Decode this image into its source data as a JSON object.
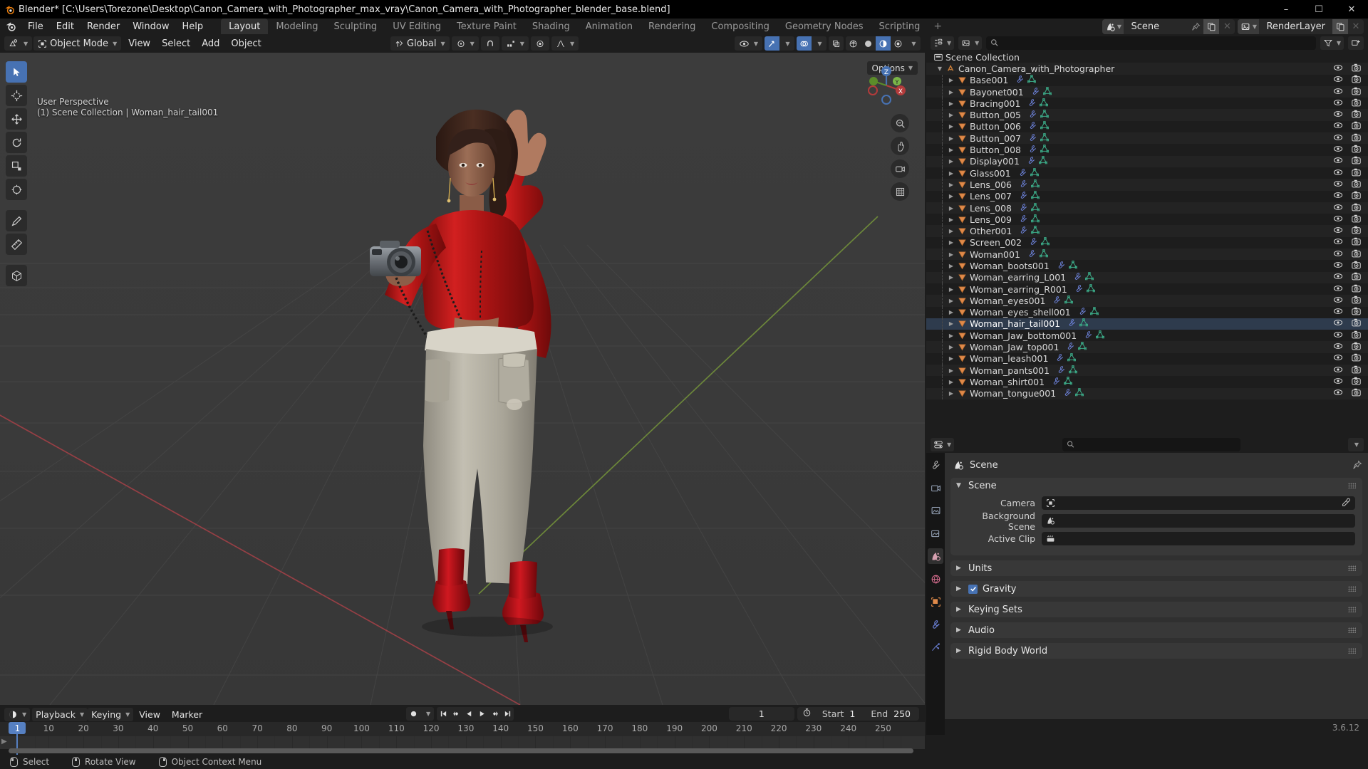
{
  "titlebar": {
    "text": "Blender* [C:\\Users\\Torezone\\Desktop\\Canon_Camera_with_Photographer_max_vray\\Canon_Camera_with_Photographer_blender_base.blend]",
    "minimize": "–",
    "maximize": "☐",
    "close": "✕"
  },
  "topbar": {
    "menus": [
      "File",
      "Edit",
      "Render",
      "Window",
      "Help"
    ],
    "workspaces": [
      {
        "label": "Layout",
        "active": true
      },
      {
        "label": "Modeling",
        "active": false
      },
      {
        "label": "Sculpting",
        "active": false
      },
      {
        "label": "UV Editing",
        "active": false
      },
      {
        "label": "Texture Paint",
        "active": false
      },
      {
        "label": "Shading",
        "active": false
      },
      {
        "label": "Animation",
        "active": false
      },
      {
        "label": "Rendering",
        "active": false
      },
      {
        "label": "Compositing",
        "active": false
      },
      {
        "label": "Geometry Nodes",
        "active": false
      },
      {
        "label": "Scripting",
        "active": false
      }
    ],
    "add_workspace": "+",
    "scene_name": "Scene",
    "viewlayer_name": "RenderLayer"
  },
  "viewport": {
    "mode": "Object Mode",
    "menus": [
      "View",
      "Select",
      "Add",
      "Object"
    ],
    "transform_orientation": "Global",
    "options_label": "Options",
    "overlay_line1": "User Perspective",
    "overlay_line2": "(1) Scene Collection | Woman_hair_tail001",
    "gizmo_axes": [
      "X",
      "Y",
      "Z"
    ]
  },
  "outliner": {
    "search_placeholder": "",
    "search_value": "",
    "root": "Scene Collection",
    "collection": "Canon_Camera_with_Photographer",
    "items": [
      {
        "label": "Base001",
        "selected": false
      },
      {
        "label": "Bayonet001",
        "selected": false
      },
      {
        "label": "Bracing001",
        "selected": false
      },
      {
        "label": "Button_005",
        "selected": false
      },
      {
        "label": "Button_006",
        "selected": false
      },
      {
        "label": "Button_007",
        "selected": false
      },
      {
        "label": "Button_008",
        "selected": false
      },
      {
        "label": "Display001",
        "selected": false
      },
      {
        "label": "Glass001",
        "selected": false
      },
      {
        "label": "Lens_006",
        "selected": false
      },
      {
        "label": "Lens_007",
        "selected": false
      },
      {
        "label": "Lens_008",
        "selected": false
      },
      {
        "label": "Lens_009",
        "selected": false
      },
      {
        "label": "Other001",
        "selected": false
      },
      {
        "label": "Screen_002",
        "selected": false
      },
      {
        "label": "Woman001",
        "selected": false
      },
      {
        "label": "Woman_boots001",
        "selected": false
      },
      {
        "label": "Woman_earring_L001",
        "selected": false
      },
      {
        "label": "Woman_earring_R001",
        "selected": false
      },
      {
        "label": "Woman_eyes001",
        "selected": false
      },
      {
        "label": "Woman_eyes_shell001",
        "selected": false
      },
      {
        "label": "Woman_hair_tail001",
        "selected": true
      },
      {
        "label": "Woman_Jaw_bottom001",
        "selected": false
      },
      {
        "label": "Woman_Jaw_top001",
        "selected": false
      },
      {
        "label": "Woman_leash001",
        "selected": false
      },
      {
        "label": "Woman_pants001",
        "selected": false
      },
      {
        "label": "Woman_shirt001",
        "selected": false
      },
      {
        "label": "Woman_tongue001",
        "selected": false
      }
    ]
  },
  "properties": {
    "search_value": "",
    "breadcrumb": "Scene",
    "panels": [
      {
        "label": "Scene",
        "open": true,
        "checkbox": false
      },
      {
        "label": "Units",
        "open": false,
        "checkbox": false
      },
      {
        "label": "Gravity",
        "open": false,
        "checkbox": true
      },
      {
        "label": "Keying Sets",
        "open": false,
        "checkbox": false
      },
      {
        "label": "Audio",
        "open": false,
        "checkbox": false
      },
      {
        "label": "Rigid Body World",
        "open": false,
        "checkbox": false
      }
    ],
    "scene_fields": [
      {
        "label": "Camera",
        "value": "",
        "icon": "camera-data-icon",
        "eyedropper": true
      },
      {
        "label": "Background Scene",
        "value": "",
        "icon": "scene-icon",
        "eyedropper": false
      },
      {
        "label": "Active Clip",
        "value": "",
        "icon": "clip-icon",
        "eyedropper": false
      }
    ],
    "version": "3.6.12"
  },
  "timeline": {
    "menus": [
      "Playback",
      "Keying",
      "View",
      "Marker"
    ],
    "current_frame": "1",
    "start_label": "Start",
    "start_value": "1",
    "end_label": "End",
    "end_value": "250",
    "ticks": [
      {
        "label": "1",
        "frame": 1
      },
      {
        "label": "10",
        "frame": 10
      },
      {
        "label": "20",
        "frame": 20
      },
      {
        "label": "30",
        "frame": 30
      },
      {
        "label": "40",
        "frame": 40
      },
      {
        "label": "50",
        "frame": 50
      },
      {
        "label": "60",
        "frame": 60
      },
      {
        "label": "70",
        "frame": 70
      },
      {
        "label": "80",
        "frame": 80
      },
      {
        "label": "90",
        "frame": 90
      },
      {
        "label": "100",
        "frame": 100
      },
      {
        "label": "110",
        "frame": 110
      },
      {
        "label": "120",
        "frame": 120
      },
      {
        "label": "130",
        "frame": 130
      },
      {
        "label": "140",
        "frame": 140
      },
      {
        "label": "150",
        "frame": 150
      },
      {
        "label": "160",
        "frame": 160
      },
      {
        "label": "170",
        "frame": 170
      },
      {
        "label": "180",
        "frame": 180
      },
      {
        "label": "190",
        "frame": 190
      },
      {
        "label": "200",
        "frame": 200
      },
      {
        "label": "210",
        "frame": 210
      },
      {
        "label": "220",
        "frame": 220
      },
      {
        "label": "230",
        "frame": 230
      },
      {
        "label": "240",
        "frame": 240
      },
      {
        "label": "250",
        "frame": 250
      }
    ]
  },
  "statusbar": {
    "items": [
      {
        "mouse": "left",
        "label": "Select"
      },
      {
        "mouse": "mid",
        "label": "Rotate View"
      },
      {
        "mouse": "right",
        "label": "Object Context Menu"
      }
    ]
  },
  "colors": {
    "accent": "#4772b3",
    "outliner_mesh": "#e08a4a",
    "modifier": "#6a7fd4",
    "mesh_data": "#3cae8a",
    "playhead": "#5680c2",
    "shirt": "#c01a1a",
    "pants": "#b9b4a6",
    "boots": "#c0131a",
    "skin": "#8a6050",
    "hair": "#3a241c"
  }
}
